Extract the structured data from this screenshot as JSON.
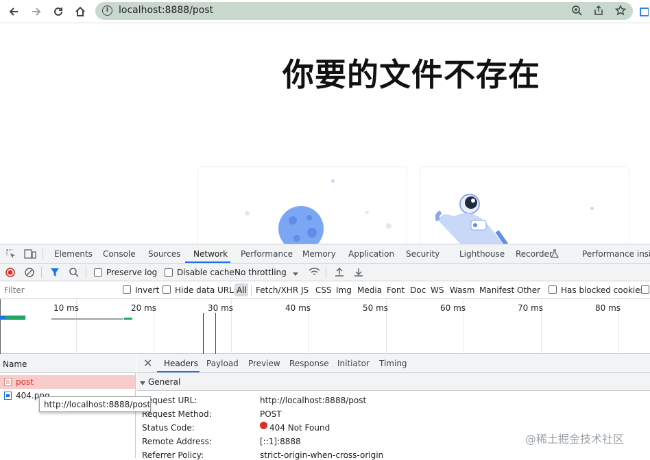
{
  "browser": {
    "url": "localhost:8888/post",
    "info_icon": "i"
  },
  "page": {
    "heading": "你要的文件不存在"
  },
  "devtools": {
    "tabs": [
      "Elements",
      "Console",
      "Sources",
      "Network",
      "Performance",
      "Memory",
      "Application",
      "Security",
      "Lighthouse",
      "Recorder",
      "Performance insigh"
    ],
    "active_tab": "Network",
    "controls": {
      "preserve_log": "Preserve log",
      "disable_cache": "Disable cache",
      "throttling": "No throttling"
    },
    "filter": {
      "placeholder": "Filter",
      "invert": "Invert",
      "hide_data_urls": "Hide data URLs",
      "types": [
        "All",
        "Fetch/XHR",
        "JS",
        "CSS",
        "Img",
        "Media",
        "Font",
        "Doc",
        "WS",
        "Wasm",
        "Manifest",
        "Other"
      ],
      "has_blocked_cookies": "Has blocked cookies"
    },
    "timeline": {
      "ticks": [
        "10 ms",
        "20 ms",
        "30 ms",
        "40 ms",
        "50 ms",
        "60 ms",
        "70 ms",
        "80 ms"
      ]
    },
    "requests": {
      "header": "Name",
      "items": [
        {
          "name": "post",
          "status": "error"
        },
        {
          "name": "404.png",
          "status": "ok"
        }
      ]
    },
    "detail": {
      "tabs": [
        "Headers",
        "Payload",
        "Preview",
        "Response",
        "Initiator",
        "Timing"
      ],
      "active_tab": "Headers",
      "section": "General",
      "fields": [
        {
          "key": "Request URL:",
          "value": "http://localhost:8888/post"
        },
        {
          "key": "Request Method:",
          "value": "POST"
        },
        {
          "key": "Status Code:",
          "value": "404 Not Found"
        },
        {
          "key": "Remote Address:",
          "value": "[::1]:8888"
        },
        {
          "key": "Referrer Policy:",
          "value": "strict-origin-when-cross-origin"
        }
      ]
    },
    "tooltip": "http://localhost:8888/post"
  },
  "watermark": "@稀土掘金技术社区",
  "colors": {
    "accent": "#1a73e8",
    "error_red": "#d93025",
    "error_row_bg": "#f9cccc"
  }
}
